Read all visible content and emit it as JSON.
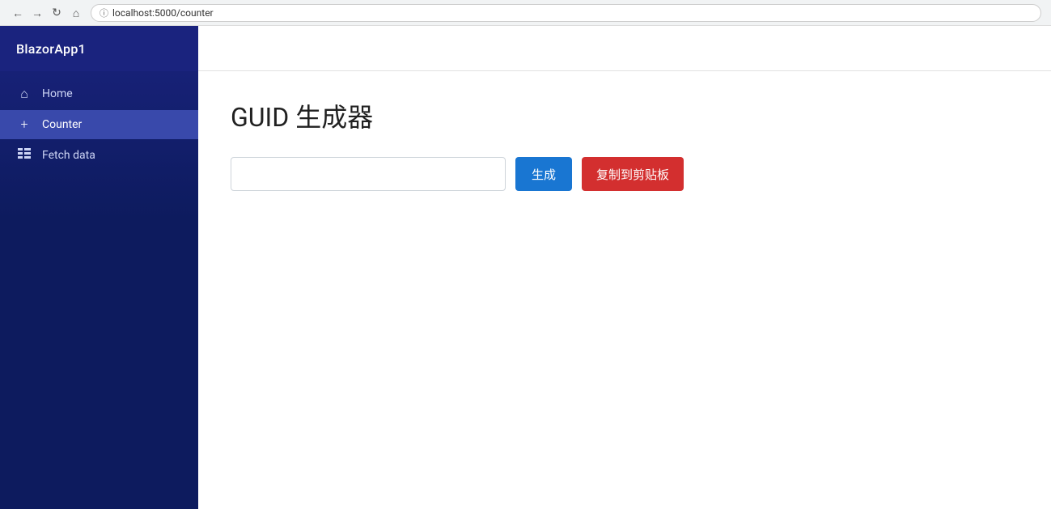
{
  "browser": {
    "url": "localhost:5000/counter"
  },
  "sidebar": {
    "logo": "BlazorApp1",
    "items": [
      {
        "id": "home",
        "label": "Home",
        "icon": "home",
        "active": false
      },
      {
        "id": "counter",
        "label": "Counter",
        "icon": "plus",
        "active": true
      },
      {
        "id": "fetch-data",
        "label": "Fetch data",
        "icon": "grid",
        "active": false
      }
    ]
  },
  "main": {
    "page_title": "GUID 生成器",
    "guid_input_value": "",
    "guid_input_placeholder": "",
    "btn_generate_label": "生成",
    "btn_copy_label": "复制到剪贴板"
  }
}
